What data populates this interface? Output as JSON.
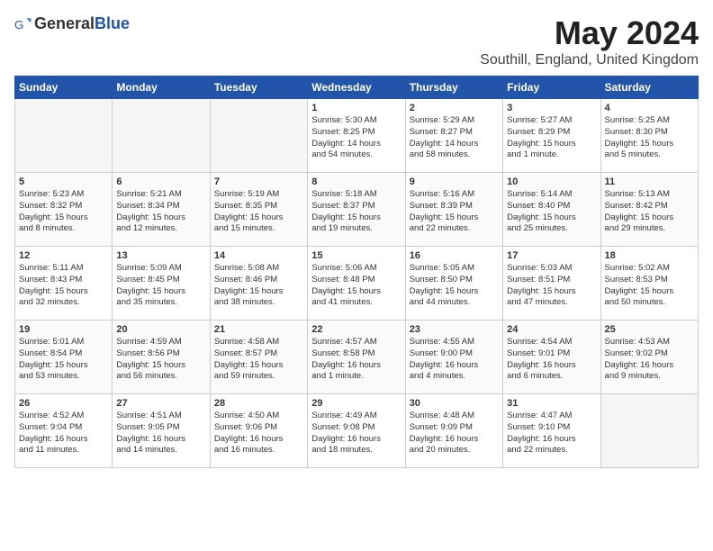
{
  "logo": {
    "general": "General",
    "blue": "Blue"
  },
  "title": {
    "month_year": "May 2024",
    "location": "Southill, England, United Kingdom"
  },
  "headers": [
    "Sunday",
    "Monday",
    "Tuesday",
    "Wednesday",
    "Thursday",
    "Friday",
    "Saturday"
  ],
  "weeks": [
    [
      {
        "day": "",
        "info": "",
        "empty": true
      },
      {
        "day": "",
        "info": "",
        "empty": true
      },
      {
        "day": "",
        "info": "",
        "empty": true
      },
      {
        "day": "1",
        "info": "Sunrise: 5:30 AM\nSunset: 8:25 PM\nDaylight: 14 hours\nand 54 minutes."
      },
      {
        "day": "2",
        "info": "Sunrise: 5:29 AM\nSunset: 8:27 PM\nDaylight: 14 hours\nand 58 minutes."
      },
      {
        "day": "3",
        "info": "Sunrise: 5:27 AM\nSunset: 8:29 PM\nDaylight: 15 hours\nand 1 minute."
      },
      {
        "day": "4",
        "info": "Sunrise: 5:25 AM\nSunset: 8:30 PM\nDaylight: 15 hours\nand 5 minutes."
      }
    ],
    [
      {
        "day": "5",
        "info": "Sunrise: 5:23 AM\nSunset: 8:32 PM\nDaylight: 15 hours\nand 8 minutes."
      },
      {
        "day": "6",
        "info": "Sunrise: 5:21 AM\nSunset: 8:34 PM\nDaylight: 15 hours\nand 12 minutes."
      },
      {
        "day": "7",
        "info": "Sunrise: 5:19 AM\nSunset: 8:35 PM\nDaylight: 15 hours\nand 15 minutes."
      },
      {
        "day": "8",
        "info": "Sunrise: 5:18 AM\nSunset: 8:37 PM\nDaylight: 15 hours\nand 19 minutes."
      },
      {
        "day": "9",
        "info": "Sunrise: 5:16 AM\nSunset: 8:39 PM\nDaylight: 15 hours\nand 22 minutes."
      },
      {
        "day": "10",
        "info": "Sunrise: 5:14 AM\nSunset: 8:40 PM\nDaylight: 15 hours\nand 25 minutes."
      },
      {
        "day": "11",
        "info": "Sunrise: 5:13 AM\nSunset: 8:42 PM\nDaylight: 15 hours\nand 29 minutes."
      }
    ],
    [
      {
        "day": "12",
        "info": "Sunrise: 5:11 AM\nSunset: 8:43 PM\nDaylight: 15 hours\nand 32 minutes."
      },
      {
        "day": "13",
        "info": "Sunrise: 5:09 AM\nSunset: 8:45 PM\nDaylight: 15 hours\nand 35 minutes."
      },
      {
        "day": "14",
        "info": "Sunrise: 5:08 AM\nSunset: 8:46 PM\nDaylight: 15 hours\nand 38 minutes."
      },
      {
        "day": "15",
        "info": "Sunrise: 5:06 AM\nSunset: 8:48 PM\nDaylight: 15 hours\nand 41 minutes."
      },
      {
        "day": "16",
        "info": "Sunrise: 5:05 AM\nSunset: 8:50 PM\nDaylight: 15 hours\nand 44 minutes."
      },
      {
        "day": "17",
        "info": "Sunrise: 5:03 AM\nSunset: 8:51 PM\nDaylight: 15 hours\nand 47 minutes."
      },
      {
        "day": "18",
        "info": "Sunrise: 5:02 AM\nSunset: 8:53 PM\nDaylight: 15 hours\nand 50 minutes."
      }
    ],
    [
      {
        "day": "19",
        "info": "Sunrise: 5:01 AM\nSunset: 8:54 PM\nDaylight: 15 hours\nand 53 minutes."
      },
      {
        "day": "20",
        "info": "Sunrise: 4:59 AM\nSunset: 8:56 PM\nDaylight: 15 hours\nand 56 minutes."
      },
      {
        "day": "21",
        "info": "Sunrise: 4:58 AM\nSunset: 8:57 PM\nDaylight: 15 hours\nand 59 minutes."
      },
      {
        "day": "22",
        "info": "Sunrise: 4:57 AM\nSunset: 8:58 PM\nDaylight: 16 hours\nand 1 minute."
      },
      {
        "day": "23",
        "info": "Sunrise: 4:55 AM\nSunset: 9:00 PM\nDaylight: 16 hours\nand 4 minutes."
      },
      {
        "day": "24",
        "info": "Sunrise: 4:54 AM\nSunset: 9:01 PM\nDaylight: 16 hours\nand 6 minutes."
      },
      {
        "day": "25",
        "info": "Sunrise: 4:53 AM\nSunset: 9:02 PM\nDaylight: 16 hours\nand 9 minutes."
      }
    ],
    [
      {
        "day": "26",
        "info": "Sunrise: 4:52 AM\nSunset: 9:04 PM\nDaylight: 16 hours\nand 11 minutes."
      },
      {
        "day": "27",
        "info": "Sunrise: 4:51 AM\nSunset: 9:05 PM\nDaylight: 16 hours\nand 14 minutes."
      },
      {
        "day": "28",
        "info": "Sunrise: 4:50 AM\nSunset: 9:06 PM\nDaylight: 16 hours\nand 16 minutes."
      },
      {
        "day": "29",
        "info": "Sunrise: 4:49 AM\nSunset: 9:08 PM\nDaylight: 16 hours\nand 18 minutes."
      },
      {
        "day": "30",
        "info": "Sunrise: 4:48 AM\nSunset: 9:09 PM\nDaylight: 16 hours\nand 20 minutes."
      },
      {
        "day": "31",
        "info": "Sunrise: 4:47 AM\nSunset: 9:10 PM\nDaylight: 16 hours\nand 22 minutes."
      },
      {
        "day": "",
        "info": "",
        "empty": true
      }
    ]
  ]
}
